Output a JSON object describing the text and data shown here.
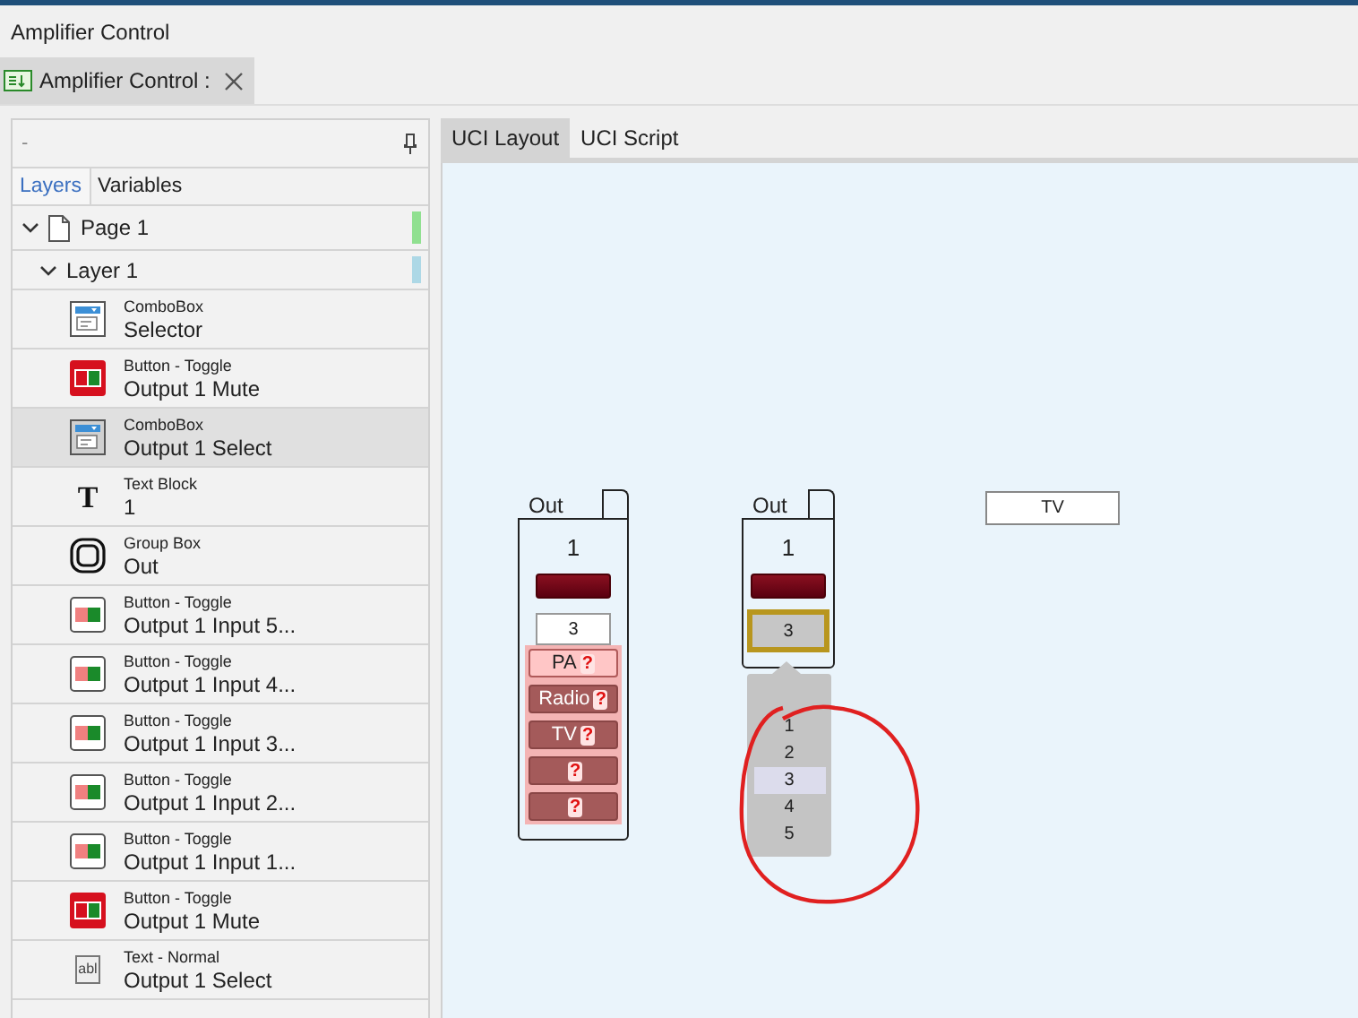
{
  "window": {
    "title": "Amplifier Control"
  },
  "document_tab": {
    "label": "Amplifier Control :"
  },
  "layers_panel": {
    "header": "-",
    "tabs": [
      {
        "label": "Layers",
        "selected": true
      },
      {
        "label": "Variables",
        "selected": false
      }
    ],
    "tree": [
      {
        "label": "Page 1",
        "kind": "page",
        "expanded": true,
        "color": "#90e090",
        "children": [
          {
            "label": "Layer 1",
            "kind": "layer",
            "expanded": true,
            "color": "#add8e6",
            "children": [
              {
                "type_label": "ComboBox",
                "label": "Selector",
                "kind": "combobox",
                "selected": false
              },
              {
                "type_label": "Button - Toggle",
                "label": "Output 1 Mute",
                "kind": "toggle-red",
                "selected": false
              },
              {
                "type_label": "ComboBox",
                "label": "Output 1 Select",
                "kind": "combobox",
                "selected": true
              },
              {
                "type_label": "Text Block",
                "label": "1",
                "kind": "text-block",
                "icon_glyph": "T",
                "selected": false
              },
              {
                "type_label": "Group Box",
                "label": "Out",
                "kind": "group-box",
                "selected": false
              },
              {
                "type_label": "Button - Toggle",
                "label": "Output 1 Input 5...",
                "kind": "toggle",
                "selected": false
              },
              {
                "type_label": "Button - Toggle",
                "label": "Output 1 Input 4...",
                "kind": "toggle",
                "selected": false
              },
              {
                "type_label": "Button - Toggle",
                "label": "Output 1 Input 3...",
                "kind": "toggle",
                "selected": false
              },
              {
                "type_label": "Button - Toggle",
                "label": "Output 1 Input 2...",
                "kind": "toggle",
                "selected": false
              },
              {
                "type_label": "Button - Toggle",
                "label": "Output 1 Input 1...",
                "kind": "toggle",
                "selected": false
              },
              {
                "type_label": "Button - Toggle",
                "label": "Output 1 Mute",
                "kind": "toggle-red",
                "selected": false
              },
              {
                "type_label": "Text - Normal",
                "label": "Output 1 Select",
                "kind": "text-normal",
                "icon_glyph": "abl",
                "selected": false
              }
            ]
          }
        ]
      }
    ]
  },
  "editor_tabs": [
    {
      "label": "UCI Layout",
      "selected": true
    },
    {
      "label": "UCI Script",
      "selected": false
    }
  ],
  "canvas": {
    "widgets": [
      {
        "title": "Out",
        "value_label": "1",
        "combobox": {
          "value": "3",
          "focused": false
        },
        "buttons": [
          {
            "label": "PA",
            "selected": true,
            "marker": "?"
          },
          {
            "label": "Radio",
            "selected": false,
            "marker": "?"
          },
          {
            "label": "TV",
            "selected": false,
            "marker": "?"
          },
          {
            "selected": false,
            "marker": "?"
          },
          {
            "selected": false,
            "marker": "?"
          }
        ]
      },
      {
        "title": "Out",
        "value_label": "1",
        "combobox": {
          "value": "3",
          "focused": true
        },
        "dropdown": {
          "items": [
            {
              "label": "1",
              "selected": false
            },
            {
              "label": "2",
              "selected": false
            },
            {
              "label": "3",
              "selected": true
            },
            {
              "label": "4",
              "selected": false
            },
            {
              "label": "5",
              "selected": false
            }
          ]
        }
      }
    ],
    "text_field": {
      "value": "TV"
    }
  }
}
